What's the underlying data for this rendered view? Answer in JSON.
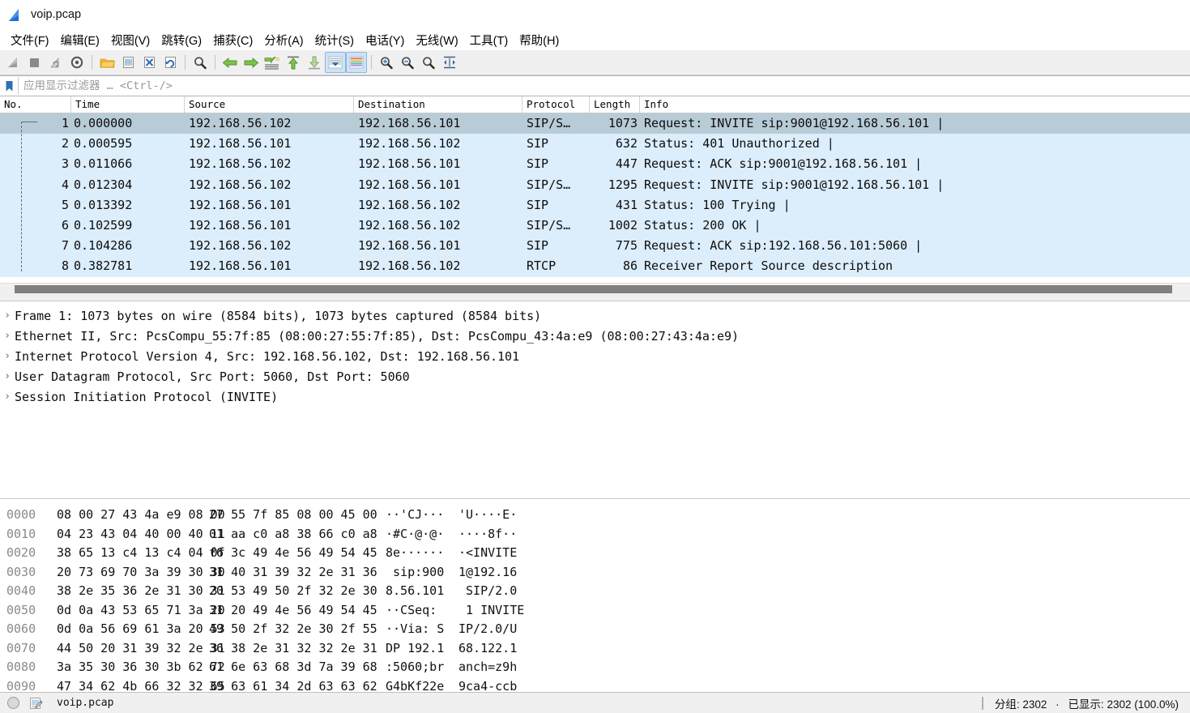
{
  "window": {
    "title": "voip.pcap",
    "app_icon": "wireshark-fin-icon"
  },
  "menu": {
    "items": [
      {
        "label": "文件(F)",
        "name": "menu-file"
      },
      {
        "label": "编辑(E)",
        "name": "menu-edit"
      },
      {
        "label": "视图(V)",
        "name": "menu-view"
      },
      {
        "label": "跳转(G)",
        "name": "menu-go"
      },
      {
        "label": "捕获(C)",
        "name": "menu-capture"
      },
      {
        "label": "分析(A)",
        "name": "menu-analyze"
      },
      {
        "label": "统计(S)",
        "name": "menu-statistics"
      },
      {
        "label": "电话(Y)",
        "name": "menu-telephony"
      },
      {
        "label": "无线(W)",
        "name": "menu-wireless"
      },
      {
        "label": "工具(T)",
        "name": "menu-tools"
      },
      {
        "label": "帮助(H)",
        "name": "menu-help"
      }
    ]
  },
  "toolbar": {
    "buttons": [
      {
        "name": "start-capture-icon"
      },
      {
        "name": "stop-capture-icon"
      },
      {
        "name": "restart-capture-icon"
      },
      {
        "name": "capture-options-icon"
      },
      {
        "name": "open-file-icon"
      },
      {
        "name": "save-file-icon"
      },
      {
        "name": "close-file-icon"
      },
      {
        "name": "reload-file-icon"
      },
      {
        "name": "find-packet-icon"
      },
      {
        "name": "go-back-icon"
      },
      {
        "name": "go-forward-icon"
      },
      {
        "name": "go-to-packet-icon"
      },
      {
        "name": "go-to-first-icon"
      },
      {
        "name": "go-to-last-icon"
      },
      {
        "name": "auto-scroll-icon"
      },
      {
        "name": "colorize-icon"
      },
      {
        "name": "zoom-in-icon"
      },
      {
        "name": "zoom-out-icon"
      },
      {
        "name": "zoom-reset-icon"
      },
      {
        "name": "resize-columns-icon"
      }
    ]
  },
  "filter": {
    "placeholder": "应用显示过滤器 … <Ctrl-/>",
    "value": "",
    "bookmark_icon": "filter-bookmark-icon"
  },
  "packet_list": {
    "columns": [
      "No.",
      "Time",
      "Source",
      "Destination",
      "Protocol",
      "Length",
      "Info"
    ],
    "rows": [
      {
        "no": "1",
        "time": "0.000000",
        "src": "192.168.56.102",
        "dst": "192.168.56.101",
        "proto": "SIP/S…",
        "len": "1073",
        "info": "Request: INVITE sip:9001@192.168.56.101  |",
        "selected": true
      },
      {
        "no": "2",
        "time": "0.000595",
        "src": "192.168.56.101",
        "dst": "192.168.56.102",
        "proto": "SIP",
        "len": "632",
        "info": "Status: 401 Unauthorized  |",
        "selected": false
      },
      {
        "no": "3",
        "time": "0.011066",
        "src": "192.168.56.102",
        "dst": "192.168.56.101",
        "proto": "SIP",
        "len": "447",
        "info": "Request: ACK sip:9001@192.168.56.101  |",
        "selected": false
      },
      {
        "no": "4",
        "time": "0.012304",
        "src": "192.168.56.102",
        "dst": "192.168.56.101",
        "proto": "SIP/S…",
        "len": "1295",
        "info": "Request: INVITE sip:9001@192.168.56.101  |",
        "selected": false
      },
      {
        "no": "5",
        "time": "0.013392",
        "src": "192.168.56.101",
        "dst": "192.168.56.102",
        "proto": "SIP",
        "len": "431",
        "info": "Status: 100 Trying  |",
        "selected": false
      },
      {
        "no": "6",
        "time": "0.102599",
        "src": "192.168.56.101",
        "dst": "192.168.56.102",
        "proto": "SIP/S…",
        "len": "1002",
        "info": "Status: 200 OK  |",
        "selected": false
      },
      {
        "no": "7",
        "time": "0.104286",
        "src": "192.168.56.102",
        "dst": "192.168.56.101",
        "proto": "SIP",
        "len": "775",
        "info": "Request: ACK sip:192.168.56.101:5060  |",
        "selected": false
      },
      {
        "no": "8",
        "time": "0.382781",
        "src": "192.168.56.101",
        "dst": "192.168.56.102",
        "proto": "RTCP",
        "len": "86",
        "info": "Receiver Report   Source description",
        "selected": false
      }
    ]
  },
  "packet_detail": {
    "rows": [
      {
        "text": "Frame 1: 1073 bytes on wire (8584 bits), 1073 bytes captured (8584 bits)"
      },
      {
        "text": "Ethernet II, Src: PcsCompu_55:7f:85 (08:00:27:55:7f:85), Dst: PcsCompu_43:4a:e9 (08:00:27:43:4a:e9)"
      },
      {
        "text": "Internet Protocol Version 4, Src: 192.168.56.102, Dst: 192.168.56.101"
      },
      {
        "text": "User Datagram Protocol, Src Port: 5060, Dst Port: 5060"
      },
      {
        "text": "Session Initiation Protocol (INVITE)"
      }
    ],
    "expander_glyph": "›"
  },
  "hex_dump": {
    "rows": [
      {
        "offset": "0000",
        "b1": "08 00 27 43 4a e9 08 00",
        "b2": "27 55 7f 85 08 00 45 00",
        "a1": "··'CJ···",
        "a2": "'U····E·"
      },
      {
        "offset": "0010",
        "b1": "04 23 43 04 40 00 40 11",
        "b2": "01 aa c0 a8 38 66 c0 a8",
        "a1": "·#C·@·@·",
        "a2": "····8f··"
      },
      {
        "offset": "0020",
        "b1": "38 65 13 c4 13 c4 04 0f",
        "b2": "f6 3c 49 4e 56 49 54 45",
        "a1": "8e······",
        "a2": "·<INVITE"
      },
      {
        "offset": "0030",
        "b1": "20 73 69 70 3a 39 30 30",
        "b2": "31 40 31 39 32 2e 31 36",
        "a1": " sip:900",
        "a2": "1@192.16"
      },
      {
        "offset": "0040",
        "b1": "38 2e 35 36 2e 31 30 31",
        "b2": "20 53 49 50 2f 32 2e 30",
        "a1": "8.56.101",
        "a2": " SIP/2.0"
      },
      {
        "offset": "0050",
        "b1": "0d 0a 43 53 65 71 3a 20",
        "b2": "31 20 49 4e 56 49 54 45",
        "a1": "··CSeq: ",
        "a2": " 1 INVITE"
      },
      {
        "offset": "0060",
        "b1": "0d 0a 56 69 61 3a 20 53",
        "b2": "49 50 2f 32 2e 30 2f 55",
        "a1": "··Via: S",
        "a2": "IP/2.0/U"
      },
      {
        "offset": "0070",
        "b1": "44 50 20 31 39 32 2e 31",
        "b2": "36 38 2e 31 32 32 2e 31",
        "a1": "DP 192.1",
        "a2": "68.122.1"
      },
      {
        "offset": "0080",
        "b1": "3a 35 30 36 30 3b 62 72",
        "b2": "61 6e 63 68 3d 7a 39 68",
        "a1": ":5060;br",
        "a2": "anch=z9h"
      },
      {
        "offset": "0090",
        "b1": "47 34 62 4b 66 32 32 65",
        "b2": "39 63 61 34 2d 63 63 62",
        "a1": "G4bKf22e",
        "a2": "9ca4-ccb"
      }
    ]
  },
  "status_bar": {
    "file_name": "voip.pcap",
    "expert_icon": "expert-info-circle-icon",
    "comment_icon": "capture-comment-icon",
    "packets_label": "分组: 2302",
    "separator": "·",
    "displayed_label": "已显示: 2302 (100.0%)"
  },
  "colors": {
    "selected_row": "#b8ccd8",
    "sip_row": "#dcedfb",
    "accent": "#1a73c8",
    "toolbar_active": "#cde4f7"
  }
}
